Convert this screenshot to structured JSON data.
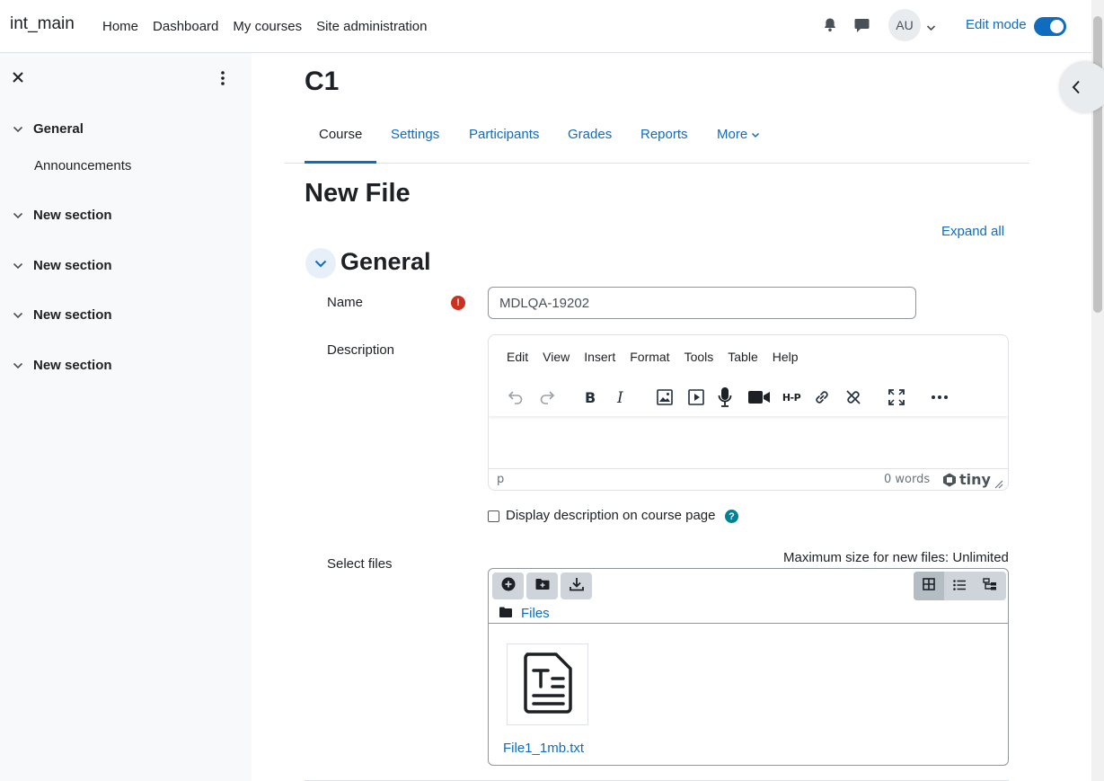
{
  "navbar": {
    "brand": "int_main",
    "links": [
      "Home",
      "Dashboard",
      "My courses",
      "Site administration"
    ],
    "avatar_initials": "AU",
    "edit_mode_label": "Edit mode",
    "edit_mode_on": true
  },
  "course_index": {
    "sections": [
      {
        "title": "General",
        "items": [
          "Announcements"
        ]
      },
      {
        "title": "New section",
        "items": []
      },
      {
        "title": "New section",
        "items": []
      },
      {
        "title": "New section",
        "items": []
      },
      {
        "title": "New section",
        "items": []
      }
    ]
  },
  "course": {
    "title": "C1",
    "tabs": [
      "Course",
      "Settings",
      "Participants",
      "Grades",
      "Reports",
      "More"
    ],
    "active_tab": "Course"
  },
  "form": {
    "page_heading": "New File",
    "expand_all": "Expand all",
    "section_heading": "General",
    "name_label": "Name",
    "name_value": "MDLQA-19202",
    "description_label": "Description",
    "editor": {
      "menus": [
        "Edit",
        "View",
        "Insert",
        "Format",
        "Tools",
        "Table",
        "Help"
      ],
      "toolbar_icons": [
        "undo-icon",
        "redo-icon",
        "bold-icon",
        "italic-icon",
        "image-icon",
        "media-icon",
        "microphone-icon",
        "video-camera-icon",
        "h5p-icon",
        "link-icon",
        "unlink-icon",
        "fullscreen-icon",
        "more-icon"
      ],
      "h5p_text": "H-P",
      "status_path": "p",
      "word_count": "0 words",
      "brand": "tiny"
    },
    "display_description_label": "Display description on course page",
    "select_files_label": "Select files",
    "max_size_text": "Maximum size for new files: Unlimited",
    "filemanager": {
      "path_label": "Files",
      "file_name": "File1_1mb.txt"
    }
  },
  "colors": {
    "link": "#0f6cbf",
    "required": "#ca3120",
    "help": "#008196",
    "drawer_bg": "#f8f9fa"
  }
}
